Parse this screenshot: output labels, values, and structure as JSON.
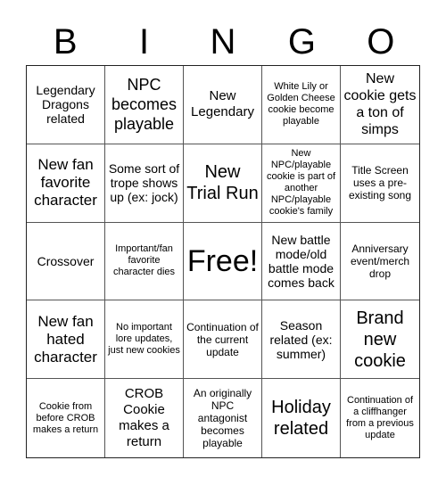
{
  "header": {
    "letters": [
      "B",
      "I",
      "N",
      "G",
      "O"
    ]
  },
  "cells": [
    "Legendary Dragons related",
    "NPC becomes playable",
    "New Legendary",
    "White Lily or Golden Cheese cookie become playable",
    "New cookie gets a ton of simps",
    "New fan favorite character",
    "Some sort of trope shows up (ex: jock)",
    "New Trial Run",
    "New NPC/playable cookie is part of another NPC/playable cookie's family",
    "Title Screen uses a pre-existing song",
    "Crossover",
    "Important/fan favorite character dies",
    "Free!",
    "New battle mode/old battle mode comes back",
    "Anniversary event/merch drop",
    "New fan hated character",
    "No important lore updates, just new cookies",
    "Continuation of the current update",
    "Season related (ex: summer)",
    "Brand new cookie",
    "Cookie from before CROB makes a return",
    "CROB Cookie makes a return",
    "An originally NPC antagonist becomes playable",
    "Holiday related",
    "Continuation of a cliffhanger from a previous update"
  ]
}
